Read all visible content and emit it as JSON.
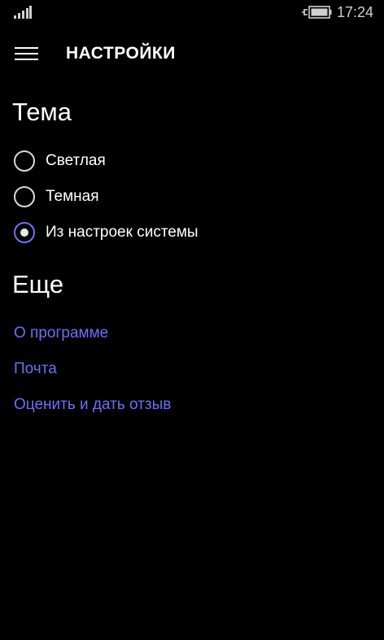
{
  "status_bar": {
    "time": "17:24",
    "signal_icon": "signal-bars-icon",
    "battery_icon": "battery-charging-icon"
  },
  "app_bar": {
    "menu_icon": "hamburger-menu-icon",
    "title": "НАСТРОЙКИ"
  },
  "theme": {
    "header": "Тема",
    "options": [
      {
        "label": "Светлая",
        "checked": false
      },
      {
        "label": "Темная",
        "checked": false
      },
      {
        "label": "Из настроек системы",
        "checked": true
      }
    ]
  },
  "more": {
    "header": "Еще",
    "links": [
      {
        "label": "О программе"
      },
      {
        "label": "Почта"
      },
      {
        "label": "Оценить и дать отзыв"
      }
    ]
  },
  "colors": {
    "background": "#000000",
    "text": "#ffffff",
    "accent": "#6a70f5"
  }
}
